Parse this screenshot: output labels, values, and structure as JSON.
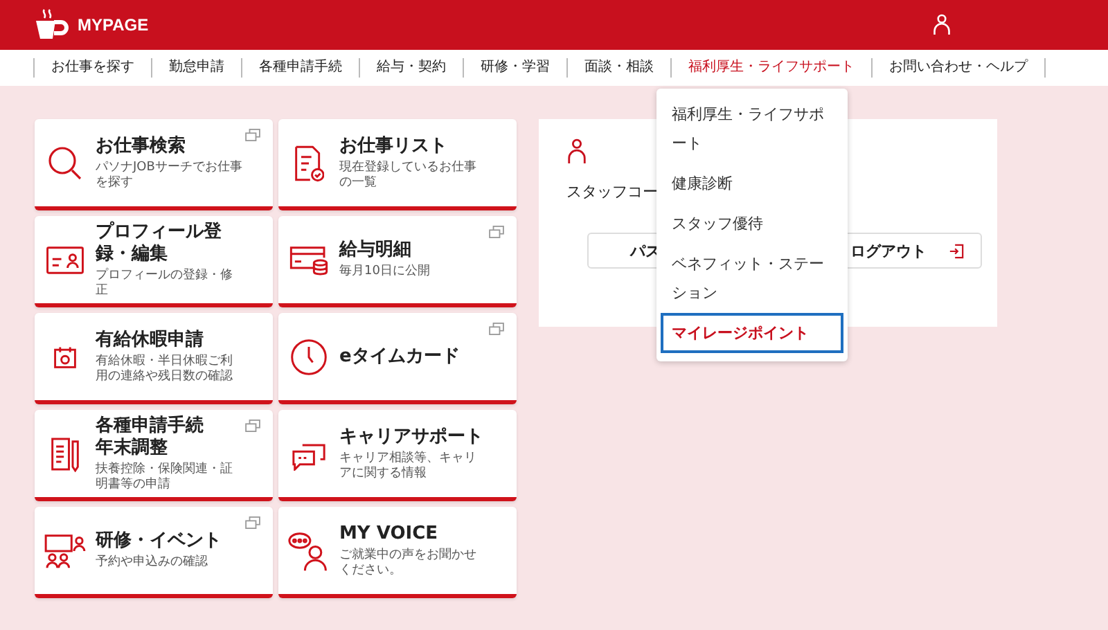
{
  "header": {
    "title": "MYPAGE"
  },
  "nav": [
    {
      "label": "お仕事を探す",
      "selected": false
    },
    {
      "label": "勤怠申請",
      "selected": false
    },
    {
      "label": "各種申請手続",
      "selected": false
    },
    {
      "label": "給与・契約",
      "selected": false
    },
    {
      "label": "研修・学習",
      "selected": false
    },
    {
      "label": "面談・相談",
      "selected": false
    },
    {
      "label": "福利厚生・ライフサポート",
      "selected": true
    },
    {
      "label": "お問い合わせ・ヘルプ",
      "selected": false
    }
  ],
  "cards": [
    {
      "title": "お仕事検索",
      "description": "パソナJOBサーチでお仕事を探す",
      "external": true
    },
    {
      "title": "お仕事リスト",
      "description": "現在登録しているお仕事の一覧",
      "external": false
    },
    {
      "title": "プロフィール登録・編集",
      "description": "プロフィールの登録・修正",
      "external": false
    },
    {
      "title": "給与明細",
      "description": "毎月10日に公開",
      "external": true
    },
    {
      "title": "有給休暇申請",
      "description": "有給休暇・半日休暇ご利用の連絡や残日数の確認",
      "external": false
    },
    {
      "title": "eタイムカード",
      "external": true
    },
    {
      "title": "各種申請手続",
      "title2": "年末調整",
      "description": "扶養控除・保険関連・証明書等の申請",
      "external": true
    },
    {
      "title": "キャリアサポート",
      "description": "キャリア相談等、キャリアに関する情報",
      "external": false
    },
    {
      "title": "研修・イベント",
      "description": "予約や申込みの確認",
      "external": true
    },
    {
      "title": "MY VOICE",
      "description": "ご就業中の声をお聞かせください。",
      "external": false
    }
  ],
  "profile": {
    "label": "スタッフコー",
    "buttons": [
      "パス",
      "ログアウト"
    ]
  },
  "dropdown": [
    {
      "label": "福利厚生・ライフサポート",
      "selected": false
    },
    {
      "label": "健康診断",
      "selected": false
    },
    {
      "label": "スタッフ優待",
      "selected": false
    },
    {
      "label": "ベネフィット・ステーション",
      "selected": false
    },
    {
      "label": "マイレージポイント",
      "selected": true
    }
  ]
}
